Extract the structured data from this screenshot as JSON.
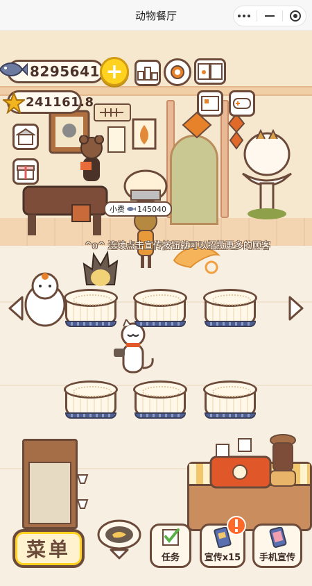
{
  "app": {
    "title": "动物餐厅"
  },
  "resources": {
    "fish": "8295641",
    "stars": "241161.8"
  },
  "hint_text": "^o^ 连续点击宣传按钮就可以招揽更多的顾客",
  "tip": {
    "label": "小费",
    "amount": "145040"
  },
  "buttons": {
    "menu": "菜单",
    "tasks": "任务",
    "promote": "宣传x15",
    "phone_promote": "手机宣传"
  },
  "colors": {
    "outline": "#6b4a3a",
    "gold": "#ffd21f",
    "alert": "#ff6a2b",
    "tablecloth_hem": "#4d5f94"
  }
}
